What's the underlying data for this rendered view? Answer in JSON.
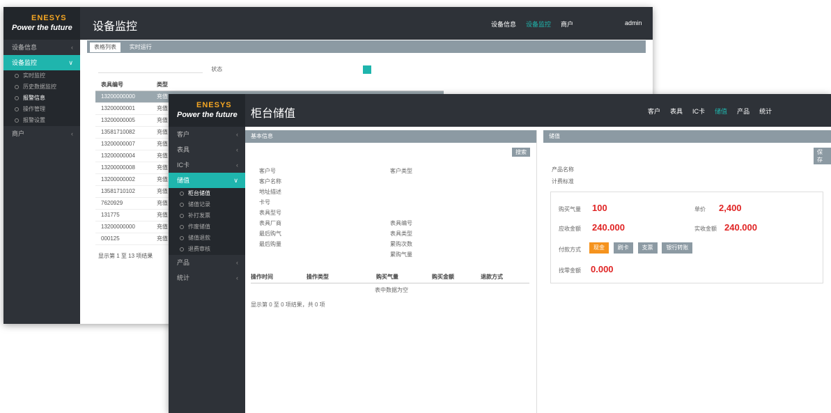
{
  "back_window": {
    "logo_line1": "ENESYS",
    "logo_line2": "Power the future",
    "title": "设备监控",
    "nav": [
      "设备信息",
      "设备监控",
      "商户",
      "admin"
    ],
    "sidebar": [
      {
        "label": "设备信息",
        "active": false
      },
      {
        "label": "设备监控",
        "active": true
      },
      {
        "label": "商户",
        "active": false
      }
    ],
    "sidebar_sub": [
      "实时监控",
      "历史数据监控",
      "报警信息",
      "操作管理",
      "报警设置"
    ],
    "tabs": [
      "表格列表",
      "实时运行"
    ],
    "filter_label": "状态",
    "table_headers": [
      "表具编号",
      "类型"
    ],
    "table_rows": [
      "13200000000",
      "13200000001",
      "13200000005",
      "13581710082",
      "13200000007",
      "13200000004",
      "13200000008",
      "13200000002",
      "13581710102",
      "7620929",
      "131775",
      "13200000000",
      "000125"
    ],
    "table_row_type": "充值",
    "footer": "显示第 1 至 13 项结果"
  },
  "front_window": {
    "logo_line1": "ENESYS",
    "logo_line2": "Power the future",
    "title": "柜台储值",
    "nav": [
      "客户",
      "表具",
      "IC卡",
      "储值",
      "产品",
      "统计"
    ],
    "nav_active_index": 3,
    "sidebar": [
      {
        "label": "客户",
        "active": false
      },
      {
        "label": "表具",
        "active": false
      },
      {
        "label": "IC卡",
        "active": false
      },
      {
        "label": "储值",
        "active": true
      }
    ],
    "sidebar_sub": [
      "柜台储值",
      "储值记录",
      "补打发票",
      "作废储值",
      "储值退款",
      "退费审核"
    ],
    "sidebar_after": [
      {
        "label": "产品",
        "active": false
      },
      {
        "label": "统计",
        "active": false
      }
    ],
    "left_panel": {
      "header": "基本信息",
      "search_btn": "搜索",
      "fields_left": [
        "客户号",
        "客户名称",
        "地址描述",
        "卡号",
        "表具型号",
        "表具厂商",
        "最后购气",
        "最后购量"
      ],
      "fields_right": [
        "客户类型",
        "表具编号",
        "表具类型",
        "累购次数",
        "累购气量"
      ],
      "table_headers": [
        "操作时间",
        "操作类型",
        "购买气量",
        "购买金额",
        "退款方式"
      ],
      "empty_text": "表中数据为空",
      "footer": "显示第 0 至 0 项结果，共 0 项"
    },
    "right_panel": {
      "header": "储值",
      "save_btn": "保存",
      "product_label": "产品名称",
      "price_label": "计费标准",
      "fields": [
        {
          "label": "购买气量",
          "value": "100"
        },
        {
          "label": "单价",
          "value": "2,400"
        },
        {
          "label": "应收金额",
          "value": "240.000"
        },
        {
          "label": "实收金额",
          "value": "240.000"
        }
      ],
      "pay_label": "付款方式",
      "pay_options": [
        "现金",
        "刷卡",
        "支票",
        "银行转账"
      ],
      "change_label": "找零金额",
      "change_value": "0.000"
    }
  }
}
